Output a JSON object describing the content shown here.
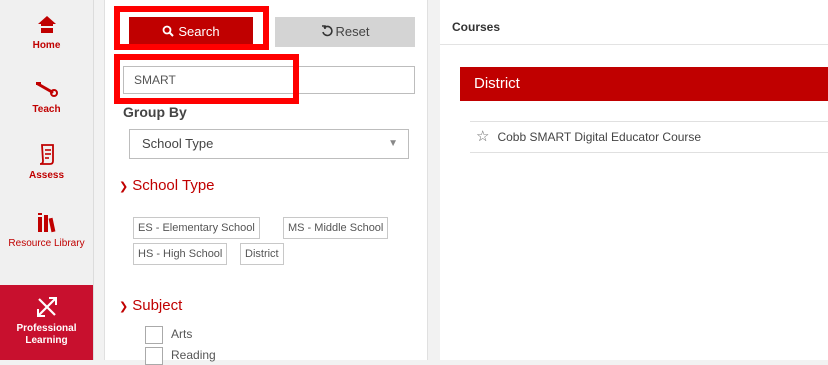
{
  "nav": {
    "items": [
      {
        "label": "Home",
        "icon": "home-icon"
      },
      {
        "label": "Teach",
        "icon": "teach-icon"
      },
      {
        "label": "Assess",
        "icon": "assess-icon"
      },
      {
        "label": "Resource Library",
        "icon": "resource-library-icon"
      },
      {
        "label": "Professional Learning",
        "icon": "professional-learning-icon",
        "active": true
      }
    ],
    "accent": "#c00000",
    "active_bg": "#c8102e"
  },
  "filter": {
    "search_label": "Search",
    "reset_label": "Reset",
    "search_value": "SMART",
    "group_by_label": "Group By",
    "group_by_value": "School Type",
    "school_type_heading": "School Type",
    "school_types": [
      "ES - Elementary School",
      "MS - Middle School",
      "HS - High School",
      "District"
    ],
    "subject_heading": "Subject",
    "subjects": [
      "Arts",
      "Reading"
    ]
  },
  "courses": {
    "title": "Courses",
    "group_heading": "District",
    "items": [
      {
        "name": "Cobb SMART Digital Educator Course"
      }
    ]
  }
}
